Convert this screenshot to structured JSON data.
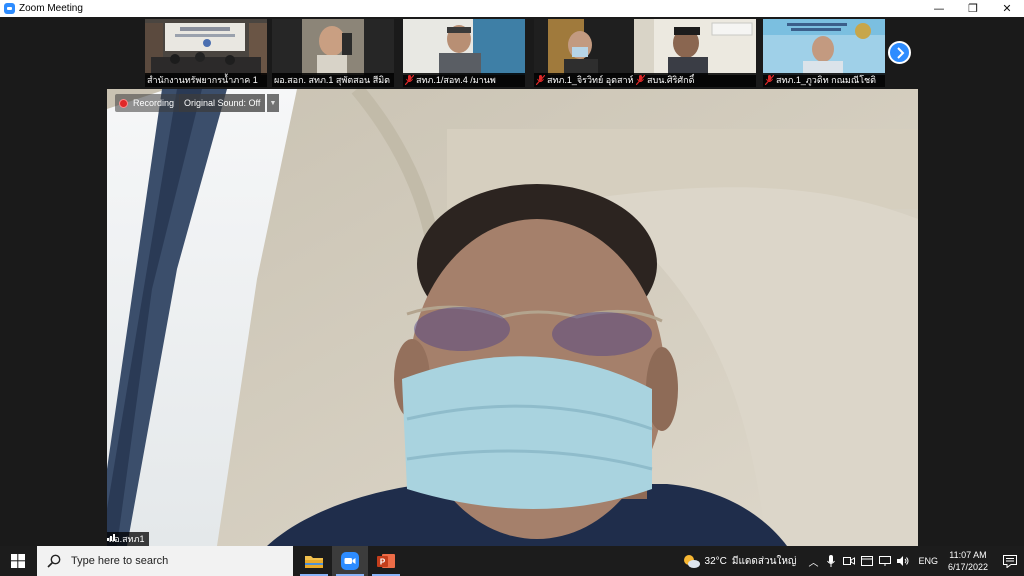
{
  "window": {
    "title": "Zoom Meeting",
    "controls": {
      "minimize": "—",
      "restore": "❐",
      "close": "✕"
    }
  },
  "participants": [
    {
      "name": "สำนักงานทรัพยากรน้ำภาค 1",
      "muted": false
    },
    {
      "name": "ผอ.สอก. สทภ.1 สุพัตสอน สีมิต",
      "muted": false
    },
    {
      "name": "สทภ.1/สอท.4 /มานพ",
      "muted": true
    },
    {
      "name": "สทภ.1_จิรวิทย์ อุตสาห์",
      "muted": true
    },
    {
      "name": "สบน.ศิริศักดิ์",
      "muted": true
    },
    {
      "name": "สทภ.1_ภูวดิท กณมณีโชติ",
      "muted": true
    }
  ],
  "main_video": {
    "recording_label": "Recording",
    "original_sound_label": "Original Sound: Off",
    "speaker_name": "ผอ.สทภ1"
  },
  "taskbar": {
    "search_placeholder": "Type here to search",
    "weather_temp": "32°C",
    "weather_condition": "มีแดดส่วนใหญ่",
    "language": "ENG",
    "time": "11:07 AM",
    "date": "6/17/2022",
    "accent_color": "#2d8cff"
  }
}
